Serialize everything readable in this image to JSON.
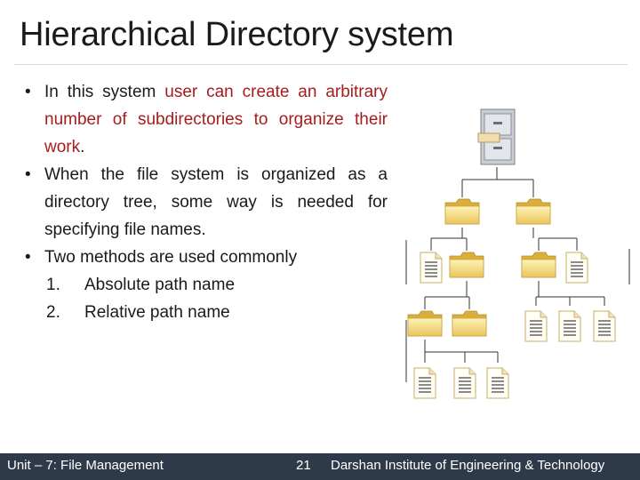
{
  "title": "Hierarchical Directory system",
  "bullets": [
    {
      "parts": [
        {
          "text": "In this system ",
          "hl": false
        },
        {
          "text": "user can create an arbitrary number of subdirectories to organize their work",
          "hl": true
        },
        {
          "text": ".",
          "hl": false
        }
      ]
    },
    {
      "parts": [
        {
          "text": "When the file system is organized as a directory tree, some way is needed for specifying file names.",
          "hl": false
        }
      ]
    },
    {
      "parts": [
        {
          "text": "Two methods are used commonly",
          "hl": false
        }
      ]
    }
  ],
  "numbered": [
    {
      "num": "1.",
      "text": "Absolute path name"
    },
    {
      "num": "2.",
      "text": "Relative path name"
    }
  ],
  "diagram": {
    "root": "cabinet-icon",
    "nodes": [
      "folder-icon",
      "file-icon"
    ]
  },
  "footer": {
    "left": "Unit – 7: File Management",
    "page": "21",
    "right": "Darshan Institute of Engineering & Technology"
  },
  "colors": {
    "highlight": "#a61c1c",
    "footer_bg": "#2e3a4a"
  }
}
